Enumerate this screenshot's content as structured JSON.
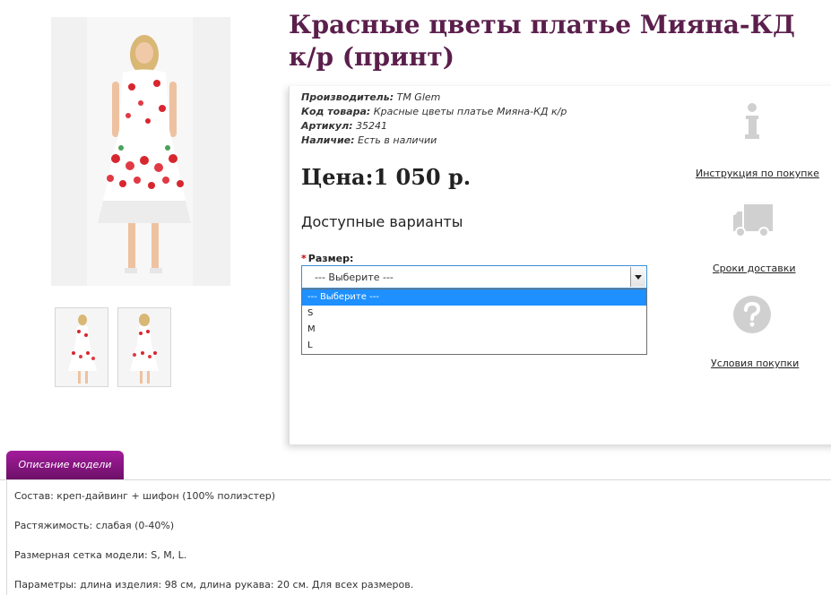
{
  "product": {
    "title": "Красные цветы платье Мияна-КД к/р (принт)"
  },
  "meta": {
    "manufacturer_label": "Производитель:",
    "manufacturer_value": "ТМ Glem",
    "code_label": "Код товара:",
    "code_value": "Красные цветы платье Мияна-КД к/р",
    "article_label": "Артикул:",
    "article_value": "35241",
    "availability_label": "Наличие:",
    "availability_value": "Есть в наличии"
  },
  "price": {
    "text": "Цена:1 050 р."
  },
  "variants": {
    "title": "Доступные варианты",
    "size_label": "Размер:",
    "required_mark": "*",
    "selected": "--- Выберите ---",
    "options": [
      "--- Выберите ---",
      "S",
      "M",
      "L"
    ]
  },
  "side_links": {
    "purchase_guide": "Инструкция по покупке",
    "delivery_terms": "Сроки доставки",
    "purchase_conditions": "Условия покупки"
  },
  "tabs": {
    "description": "Описание модели"
  },
  "description": {
    "composition_label": "Состав:",
    "composition_value": "креп-дайвинг + шифон (100% полиэстер)",
    "stretch_label": "Растяжимость:",
    "stretch_value": "слабая (0-40%)",
    "sizes_label": "Размерная сетка модели:",
    "sizes_value": "S, M, L.",
    "params_label": "Параметры:",
    "params_value": "длина изделия: 98 см, длина рукава: 20 см. Для всех размеров."
  },
  "colors": {
    "title": "#5b1f4c",
    "tab_bg": "#8a1784",
    "select_highlight": "#1e90ff",
    "icon_grey": "#d0d0d0"
  },
  "icons": {
    "info": "info-icon",
    "truck": "truck-icon",
    "question": "question-icon"
  }
}
